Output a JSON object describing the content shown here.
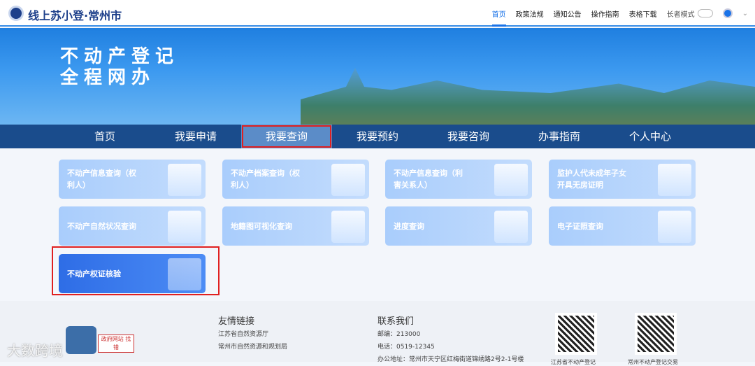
{
  "header": {
    "site_title": "线上苏小登·常州市",
    "nav": [
      "首页",
      "政策法规",
      "通知公告",
      "操作指南",
      "表格下载"
    ],
    "active": "首页",
    "elder_mode": "长者模式"
  },
  "banner": {
    "line1": "不动产登记",
    "line2": "全程网办"
  },
  "main_nav": [
    "首页",
    "我要申请",
    "我要查询",
    "我要预约",
    "我要咨询",
    "办事指南",
    "个人中心"
  ],
  "main_nav_active": "我要查询",
  "cards": [
    "不动产信息查询（权利人）",
    "不动产档案查询（权利人）",
    "不动产信息查询（利害关系人）",
    "监护人代未成年子女开具无房证明",
    "不动产自然状况查询",
    "地籍图可视化查询",
    "进度查询",
    "电子证照查询",
    "不动产权证核验"
  ],
  "footer": {
    "links_title": "友情链接",
    "links": [
      "江苏省自然资源厅",
      "常州市自然资源和规划局"
    ],
    "contact_title": "联系我们",
    "postcode": "邮编：213000",
    "phone": "电话：0519-12345",
    "address": "办公地址：常州市天宁区红梅街道锦绣路2号2-1号楼",
    "qr_captions": [
      "江苏省不动产登记",
      "常州不动产登记交易"
    ],
    "gov_badge": "政府网站 找错",
    "watermark": "大数跨境"
  }
}
